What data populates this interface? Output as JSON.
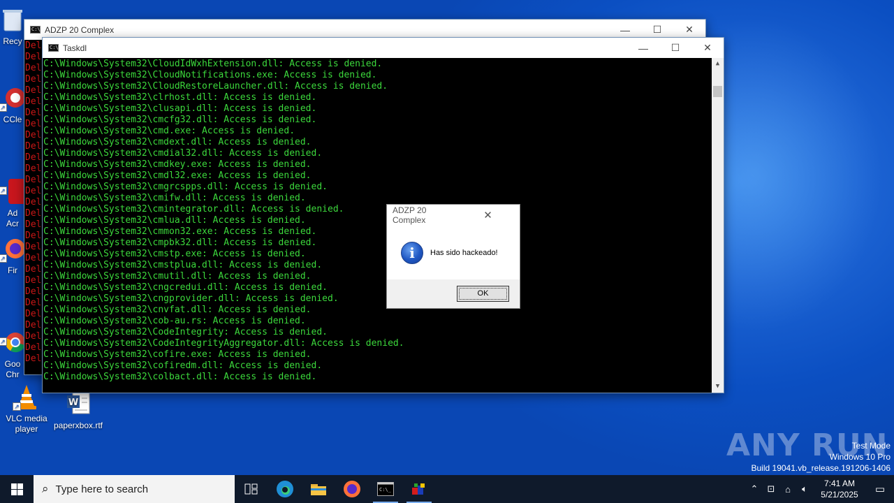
{
  "desktop": {
    "icons": [
      {
        "label": "Recy"
      },
      {
        "label": "CCle"
      },
      {
        "label": "Ad\nAcr"
      },
      {
        "label": "Fir"
      },
      {
        "label": "Goo\nChr"
      },
      {
        "label": "VLC media player"
      },
      {
        "label": "paperxbox.rtf"
      }
    ]
  },
  "back_window": {
    "title": "ADZP 20 Complex",
    "line_text": "Del",
    "line_count": 29
  },
  "front_window": {
    "title": "Taskdl",
    "lines": [
      "C:\\Windows\\System32\\CloudIdWxhExtension.dll: Access is denied.",
      "C:\\Windows\\System32\\CloudNotifications.exe: Access is denied.",
      "C:\\Windows\\System32\\CloudRestoreLauncher.dll: Access is denied.",
      "C:\\Windows\\System32\\clrhost.dll: Access is denied.",
      "C:\\Windows\\System32\\clusapi.dll: Access is denied.",
      "C:\\Windows\\System32\\cmcfg32.dll: Access is denied.",
      "C:\\Windows\\System32\\cmd.exe: Access is denied.",
      "C:\\Windows\\System32\\cmdext.dll: Access is denied.",
      "C:\\Windows\\System32\\cmdial32.dll: Access is denied.",
      "C:\\Windows\\System32\\cmdkey.exe: Access is denied.",
      "C:\\Windows\\System32\\cmdl32.exe: Access is denied.",
      "C:\\Windows\\System32\\cmgrcspps.dll: Access is denied.",
      "C:\\Windows\\System32\\cmifw.dll: Access is denied.",
      "C:\\Windows\\System32\\cmintegrator.dll: Access is denied.",
      "C:\\Windows\\System32\\cmlua.dll: Access is denied.",
      "C:\\Windows\\System32\\cmmon32.exe: Access is denied.",
      "C:\\Windows\\System32\\cmpbk32.dll: Access is denied.",
      "C:\\Windows\\System32\\cmstp.exe: Access is denied.",
      "C:\\Windows\\System32\\cmstplua.dll: Access is denied.",
      "C:\\Windows\\System32\\cmutil.dll: Access is denied.",
      "C:\\Windows\\System32\\cngcredui.dll: Access is denied.",
      "C:\\Windows\\System32\\cngprovider.dll: Access is denied.",
      "C:\\Windows\\System32\\cnvfat.dll: Access is denied.",
      "C:\\Windows\\System32\\cob-au.rs: Access is denied.",
      "C:\\Windows\\System32\\CodeIntegrity: Access is denied.",
      "C:\\Windows\\System32\\CodeIntegrityAggregator.dll: Access is denied.",
      "C:\\Windows\\System32\\cofire.exe: Access is denied.",
      "C:\\Windows\\System32\\cofiredm.dll: Access is denied.",
      "C:\\Windows\\System32\\colbact.dll: Access is denied."
    ]
  },
  "dialog": {
    "title": "ADZP 20 Complex",
    "message": "Has sido hackeado!",
    "ok_label": "OK"
  },
  "watermark": {
    "brand": "ANY RUN",
    "mode": "Test Mode",
    "edition": "Windows 10 Pro",
    "build": "Build 19041.vb_release.191206-1406"
  },
  "taskbar": {
    "search_placeholder": "Type here to search",
    "time": "7:41 AM",
    "date": "5/21/2025"
  }
}
